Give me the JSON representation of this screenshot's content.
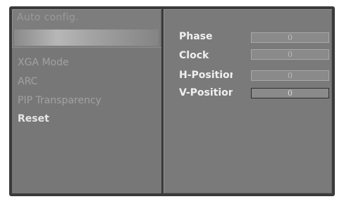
{
  "menu": {
    "title": "Auto config.",
    "items": [
      {
        "label": "XGA Mode",
        "active": false
      },
      {
        "label": "ARC",
        "active": false
      },
      {
        "label": "PIP Transparency",
        "active": false
      },
      {
        "label": "Reset",
        "active": true
      }
    ]
  },
  "settings": {
    "params": [
      {
        "label": "Phase",
        "value": "0"
      },
      {
        "label": "Clock",
        "value": "0"
      },
      {
        "label": "H-Position",
        "value": "0"
      },
      {
        "label": "V-Position",
        "value": "0",
        "selected": true
      }
    ]
  }
}
